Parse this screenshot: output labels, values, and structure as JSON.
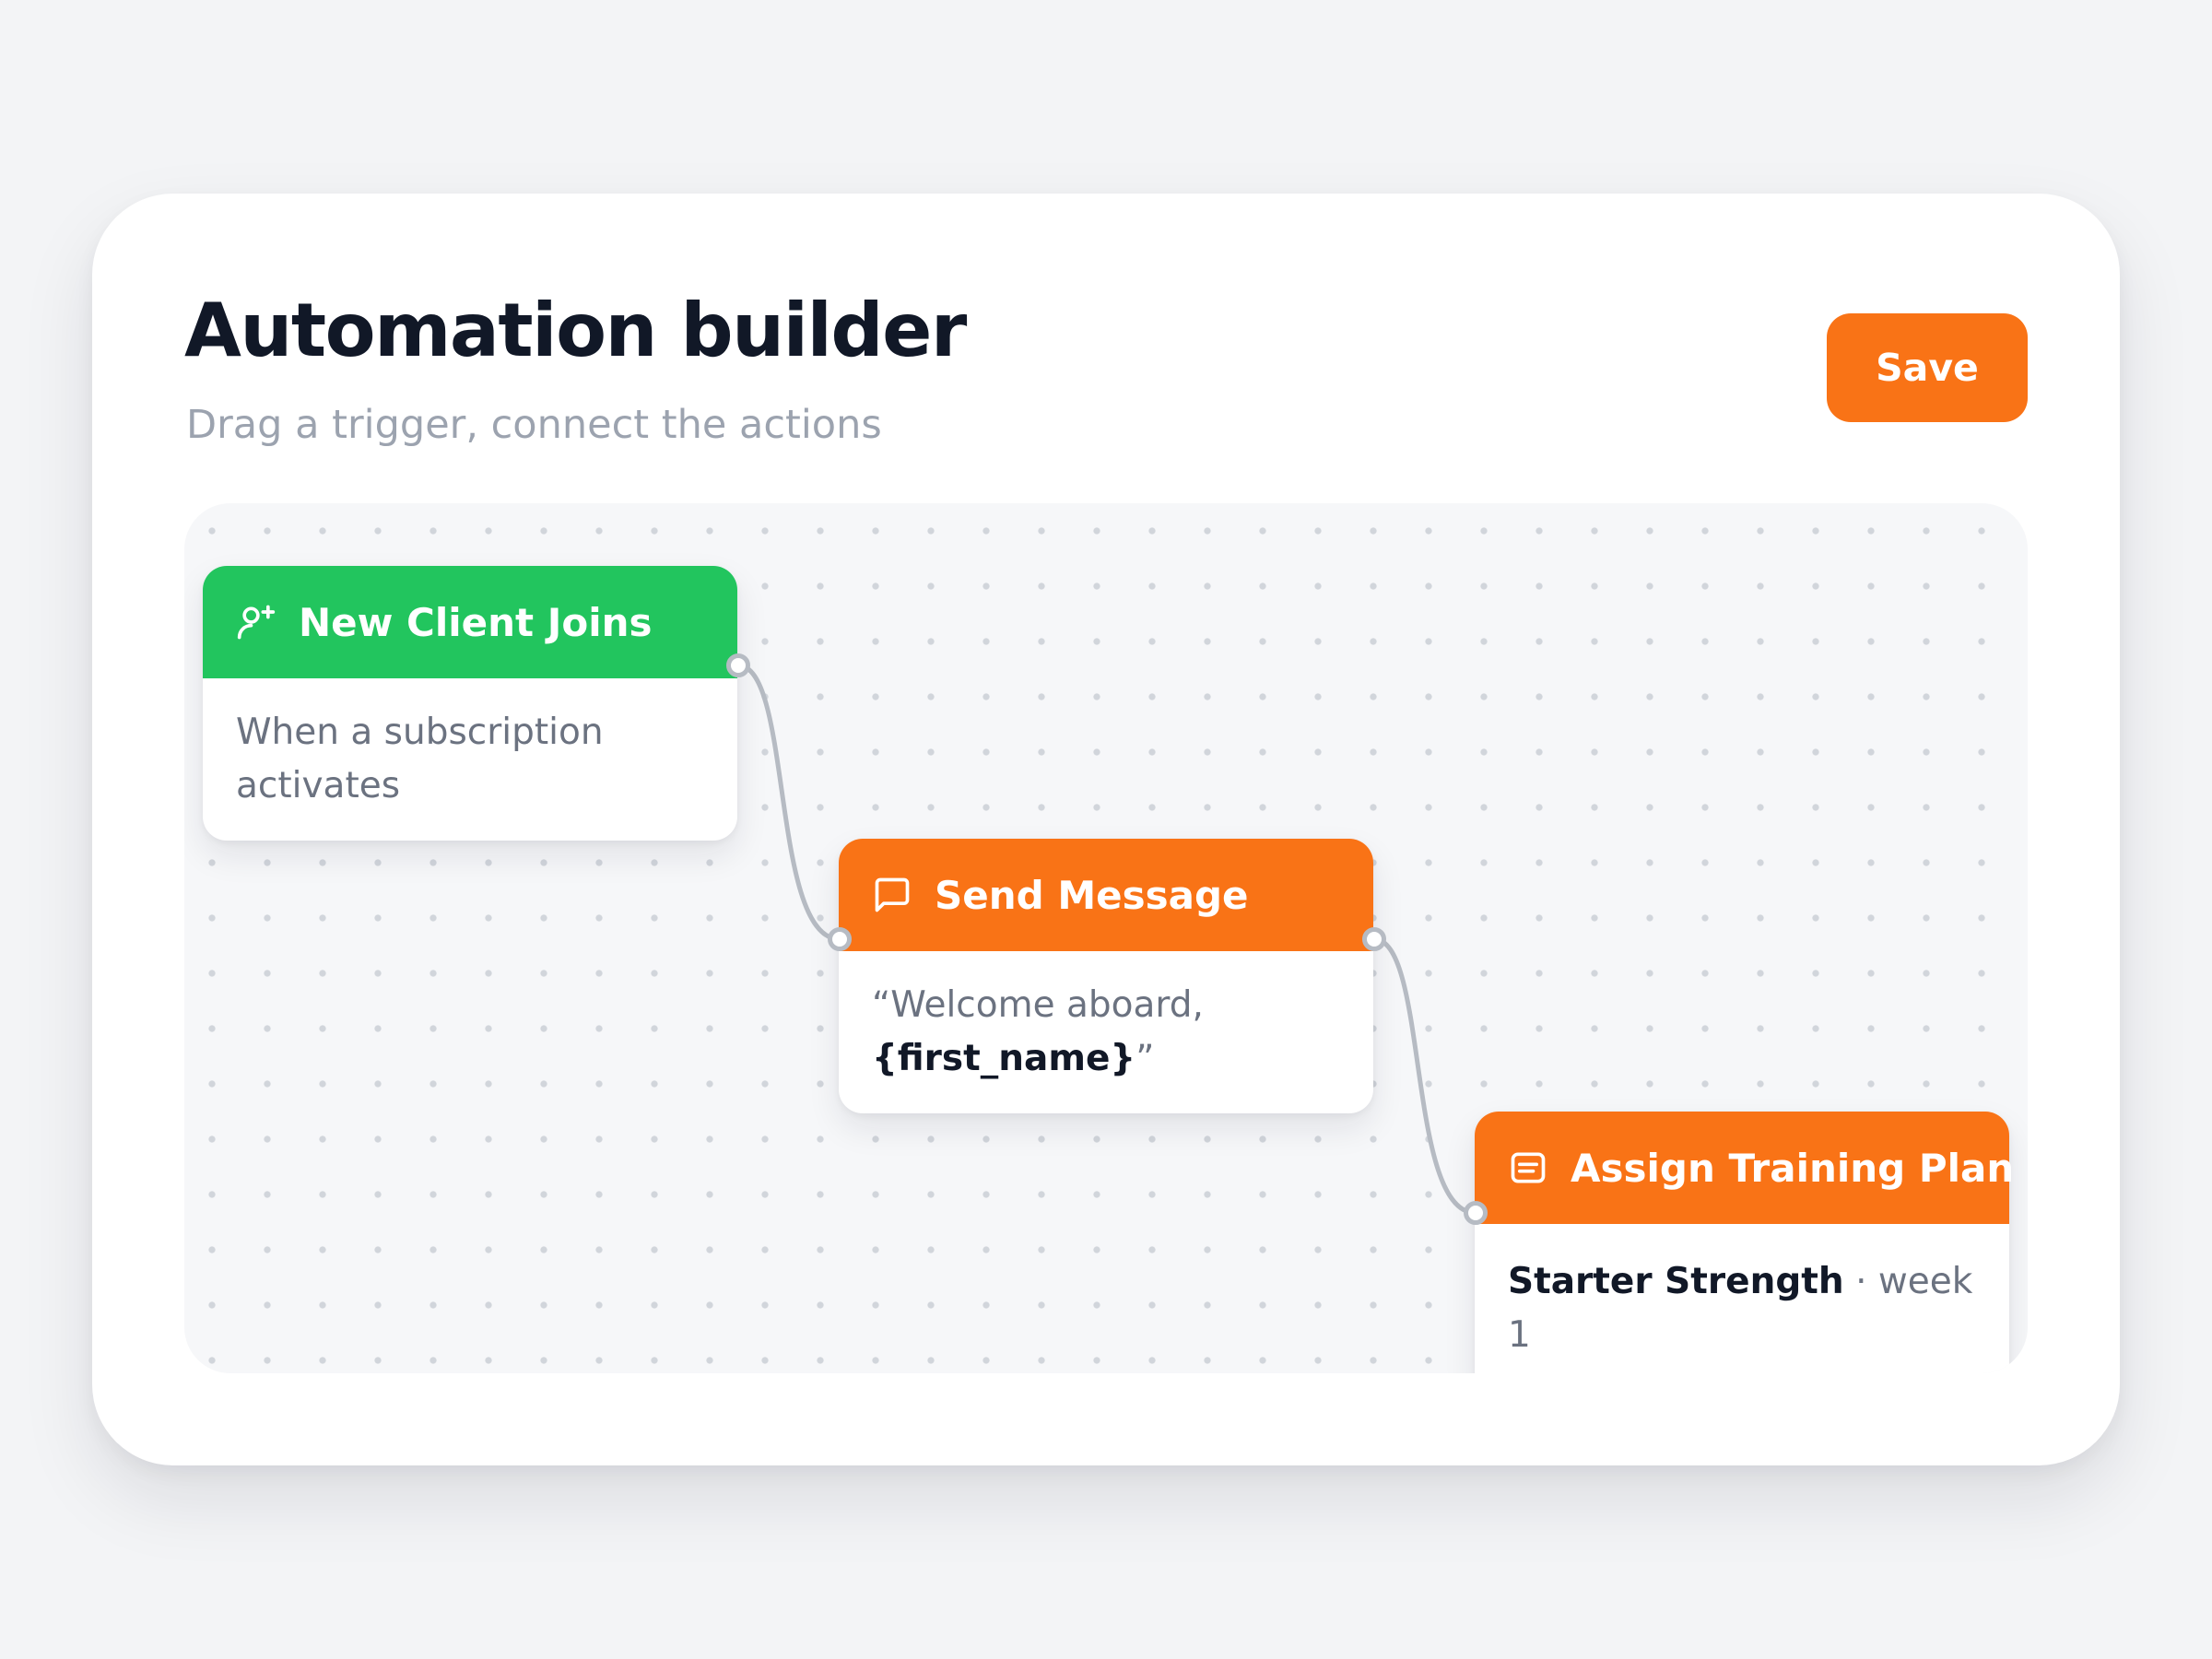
{
  "header": {
    "title": "Automation builder",
    "subtitle": "Drag a trigger, connect the actions",
    "save_label": "Save"
  },
  "colors": {
    "accent": "#f97316",
    "trigger": "#22c55e",
    "connector": "#b6bbc3",
    "title": "#111827",
    "muted": "#9ca3af"
  },
  "nodes": {
    "trigger": {
      "icon": "user-plus-icon",
      "title": "New Client Joins",
      "description": "When a subscription activates"
    },
    "message": {
      "icon": "message-icon",
      "title": "Send Message",
      "text_open": "“Welcome aboard, ",
      "variable": "{first_name}",
      "text_close": "”"
    },
    "plan": {
      "icon": "clipboard-icon",
      "title": "Assign Training Plan",
      "plan_name": "Starter Strength",
      "plan_suffix": " · week 1"
    }
  }
}
